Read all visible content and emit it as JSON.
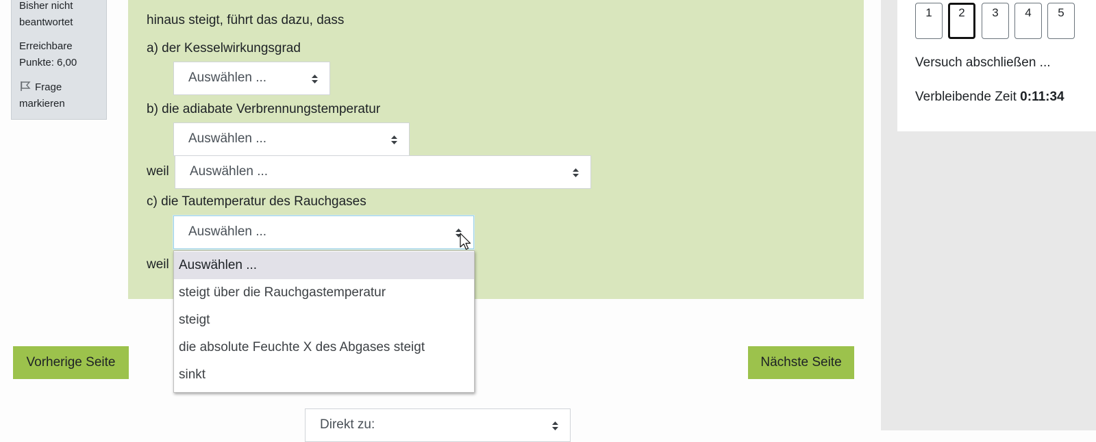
{
  "info": {
    "state": "Bisher nicht beantwortet",
    "grade": "Erreichbare Punkte: 6,00",
    "flag_label": "Frage markieren",
    "flag_icon": "flag-icon"
  },
  "question": {
    "intro_line": "hinaus steigt, führt das dazu, dass",
    "part_a": "a) der Kesselwirkungsgrad",
    "part_b": "b) die adiabate Verbrennungstemperatur",
    "part_c": "c) die Tautemperatur des Rauchgases",
    "weil": "weil"
  },
  "selects": {
    "a": "Auswählen ...",
    "b": "Auswählen ...",
    "b_weil": "Auswählen ...",
    "c": "Auswählen ..."
  },
  "dropdown": {
    "options": [
      "Auswählen ...",
      "steigt über die Rauchgastemperatur",
      "steigt",
      "die absolute Feuchte X des Abgases steigt",
      "sinkt"
    ],
    "selected_index": 0
  },
  "buttons": {
    "prev": "Vorherige Seite",
    "next": "Nächste Seite"
  },
  "jump": {
    "label": "Direkt zu:"
  },
  "nav": {
    "question_numbers": [
      "1",
      "2",
      "3",
      "4",
      "5"
    ],
    "current": "2",
    "finish_link": "Versuch abschließen ...",
    "timer_label": "Verbleibende Zeit",
    "timer_value": "0:11:34"
  },
  "colors": {
    "content_bg": "#d9e6bd",
    "button_bg": "#9cc24c",
    "info_bg": "#dee2e6",
    "drawer_bg": "#e8e8e8"
  }
}
